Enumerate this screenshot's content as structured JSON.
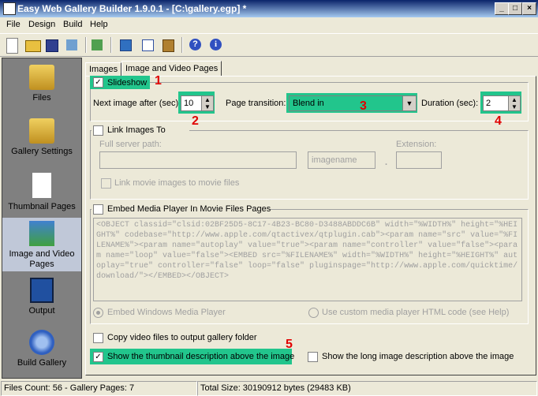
{
  "window": {
    "title": "Easy Web Gallery Builder 1.9.0.1 - [C:\\gallery.egp] *"
  },
  "menu": [
    "File",
    "Design",
    "Build",
    "Help"
  ],
  "nav": [
    {
      "label": "Files",
      "icon": "folder-icon"
    },
    {
      "label": "Gallery Settings",
      "icon": "gallery-settings-icon"
    },
    {
      "label": "Thumbnail Pages",
      "icon": "thumbnail-page-icon"
    },
    {
      "label": "Image and Video Pages",
      "icon": "image-page-icon"
    },
    {
      "label": "Output",
      "icon": "output-icon"
    },
    {
      "label": "Build Gallery",
      "icon": "gear-icon"
    }
  ],
  "tabs": [
    "Images",
    "Image and Video Pages"
  ],
  "slideshow": {
    "label": "Slideshow",
    "checked": true,
    "marker": "1"
  },
  "next_image": {
    "label": "Next image after (sec):",
    "value": "10",
    "marker": "2"
  },
  "transition": {
    "label": "Page transition:",
    "value": "Blend in",
    "marker": "3"
  },
  "duration": {
    "label": "Duration (sec):",
    "value": "2",
    "marker": "4"
  },
  "link_images": {
    "label": "Link Images To",
    "server_path_label": "Full server path:",
    "server_path_value": "",
    "imagename_value": "imagename",
    "extension_label": "Extension:",
    "extension_value": "",
    "link_movie_label": "Link movie images to movie files"
  },
  "embed": {
    "label": "Embed Media Player In Movie Files Pages",
    "code": "<OBJECT classid=\"clsid:02BF25D5-8C17-4B23-BC80-D3488ABDDC6B\" width=\"%WIDTH%\" height=\"%HEIGHT%\" codebase=\"http://www.apple.com/qtactivex/qtplugin.cab\"><param name=\"src\" value=\"%FILENAME%\"><param name=\"autoplay\" value=\"true\"><param name=\"controller\" value=\"false\"><param name=\"loop\" value=\"false\"><EMBED src=\"%FILENAME%\" width=\"%WIDTH%\" height=\"%HEIGHT%\" autoplay=\"true\" controller=\"false\" loop=\"false\" pluginspage=\"http://www.apple.com/quicktime/download/\"></EMBED></OBJECT>",
    "radio_windows": "Embed Windows Media Player",
    "radio_custom": "Use custom media player HTML code (see Help)"
  },
  "copy_video": {
    "label": "Copy video files to output gallery folder",
    "checked": false
  },
  "show_thumb_desc": {
    "label": "Show the thumbnail description above the image",
    "checked": true,
    "marker": "5"
  },
  "show_long_desc": {
    "label": "Show the long image description above the image",
    "checked": false
  },
  "status": {
    "files": "Files Count: 56 - Gallery Pages: 7",
    "size": "Total Size: 30190912 bytes (29483 KB)"
  },
  "colors": {
    "highlight": "#22c58c",
    "marker": "#e00000"
  }
}
